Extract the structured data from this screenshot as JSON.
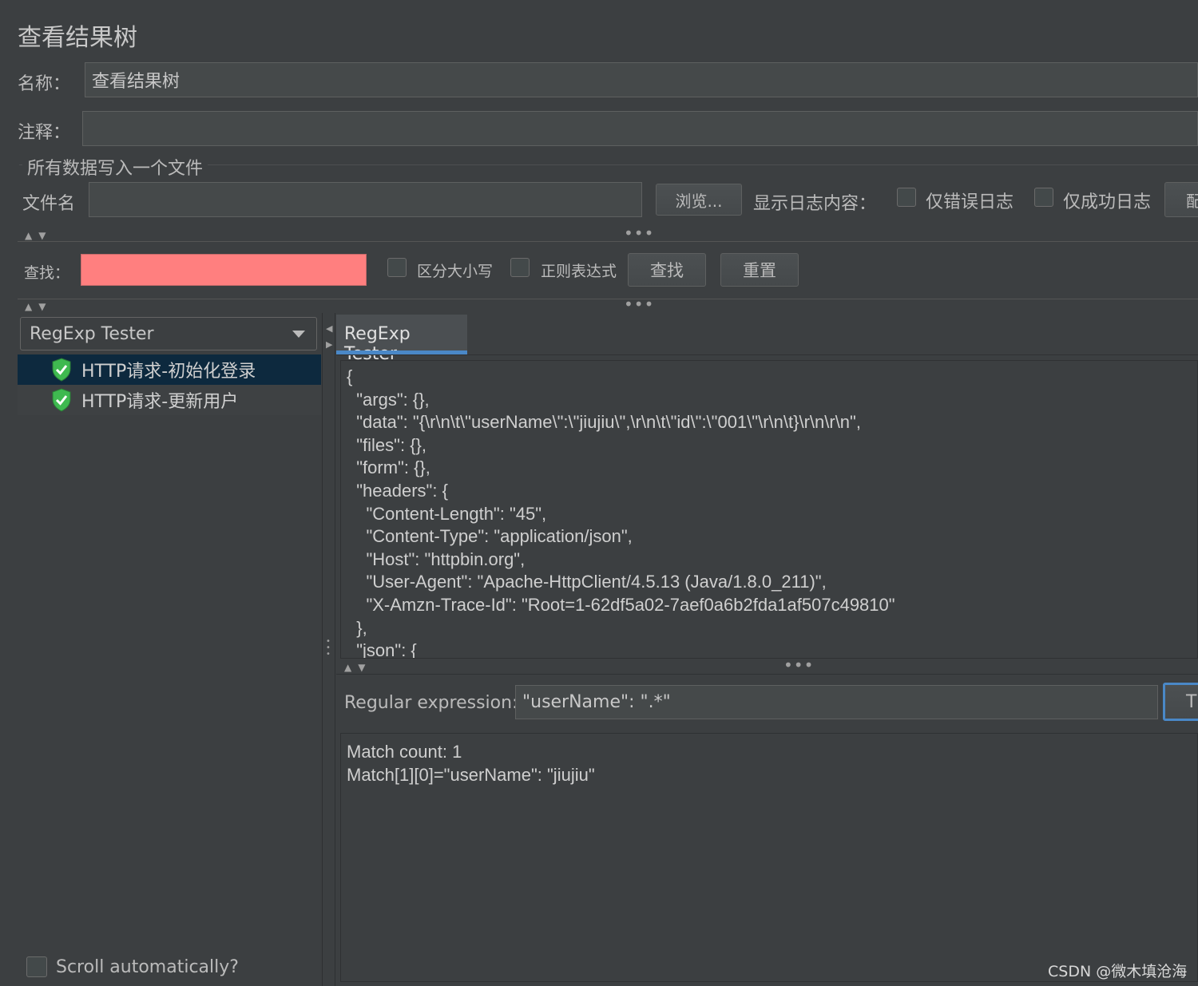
{
  "panel": {
    "title": "查看结果树"
  },
  "name_row": {
    "label": "名称：",
    "value": "查看结果树"
  },
  "comment_row": {
    "label": "注释：",
    "value": ""
  },
  "file_section": {
    "legend": "所有数据写入一个文件",
    "filename_label": "文件名",
    "filename_value": "",
    "browse_label": "浏览...",
    "log_content_label": "显示日志内容：",
    "errors_only_label": "仅错误日志",
    "success_only_label": "仅成功日志",
    "config_label": "配"
  },
  "search": {
    "label": "查找：",
    "value": "",
    "case_label": "区分大小写",
    "regex_label": "正则表达式",
    "find_label": "查找",
    "reset_label": "重置"
  },
  "renderer_select": {
    "value": "RegExp Tester"
  },
  "tree": {
    "items": [
      {
        "label": "HTTP请求-初始化登录",
        "selected": true
      },
      {
        "label": "HTTP请求-更新用户",
        "selected": false
      }
    ]
  },
  "scroll_auto": {
    "label": "Scroll automatically?"
  },
  "tab": {
    "label": "RegExp Tester"
  },
  "response_lines": [
    "{",
    "  \"args\": {},",
    "  \"data\": \"{\\r\\n\\t\\\"userName\\\":\\\"jiujiu\\\",\\r\\n\\t\\\"id\\\":\\\"001\\\"\\r\\n\\t}\\r\\n\\r\\n\",",
    "  \"files\": {},",
    "  \"form\": {},",
    "  \"headers\": {",
    "    \"Content-Length\": \"45\",",
    "    \"Content-Type\": \"application/json\",",
    "    \"Host\": \"httpbin.org\",",
    "    \"User-Agent\": \"Apache-HttpClient/4.5.13 (Java/1.8.0_211)\",",
    "    \"X-Amzn-Trace-Id\": \"Root=1-62df5a02-7aef0a6b2fda1af507c49810\"",
    "  },",
    "  \"json\": {"
  ],
  "regex": {
    "label": "Regular expression:",
    "value": "\"userName\": \".*\"",
    "test_label": "T"
  },
  "result_lines": [
    "Match count: 1",
    "Match[1][0]=\"userName\": \"jiujiu\""
  ],
  "watermark": "CSDN @微木填沧海",
  "colors": {
    "background": "#3c3f41",
    "search_field_error": "#ff7f7f",
    "selected_row": "#0d293e",
    "tab_underline": "#4a88c7",
    "shield_green": "#3fb950"
  }
}
